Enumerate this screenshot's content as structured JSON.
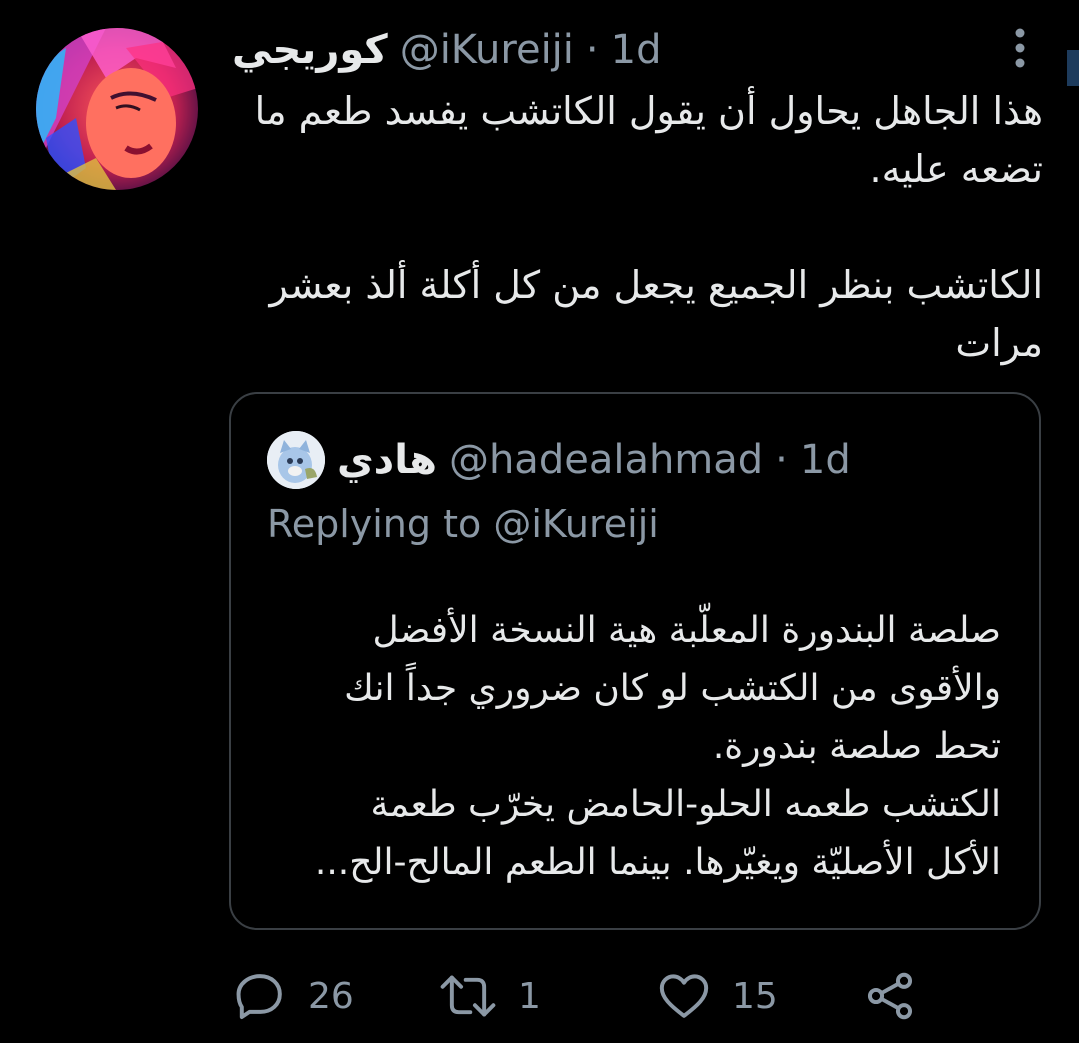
{
  "tweet": {
    "display_name": "كوريجي",
    "handle": "@iKureiji",
    "separator": "·",
    "time": "1d",
    "text_lines": [
      "هذا الجاهل يحاول أن يقول الكاتشب يفسد طعم ما تضعه عليه.",
      "الكاتشب بنظر الجميع يجعل من كل أكلة ألذ بعشر مرات"
    ]
  },
  "quoted_tweet": {
    "display_name": "هادي",
    "handle": "@hadealahmad",
    "separator": "·",
    "time": "1d",
    "replying_label": "Replying to",
    "replying_to": "@iKureiji",
    "text_lines": [
      "صلصة البندورة المعلّبة هية النسخة الأفضل والأقوى من الكتشب لو كان ضروري جداً انك تحط صلصة بندورة.",
      "الكتشب طعمه الحلو-الحامض يخرّب طعمة الأكل الأصليّة ويغيّرها. بينما الطعم المالح-الح..."
    ]
  },
  "actions": {
    "reply_count": "26",
    "retweet_count": "1",
    "like_count": "15"
  },
  "icons": {
    "more": "more-vertical-icon",
    "reply": "reply-icon",
    "retweet": "retweet-icon",
    "like": "heart-icon",
    "share": "share-icon"
  },
  "colors": {
    "background": "#000000",
    "text": "#e7e9ea",
    "muted": "#8b98a5",
    "border": "#3a3f44"
  }
}
